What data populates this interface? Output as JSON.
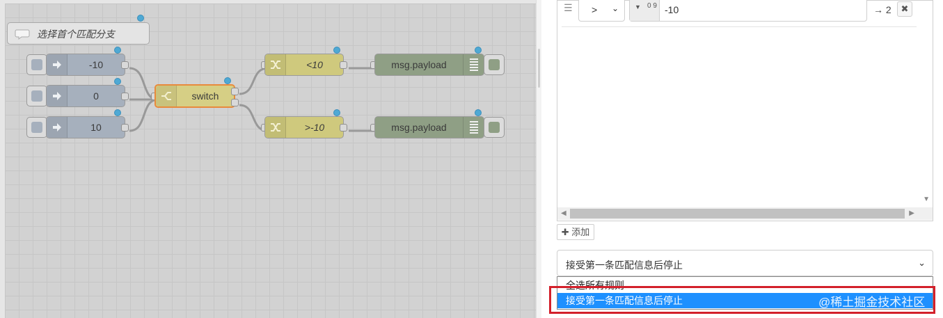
{
  "workspace": {
    "comment_label": "选择首个匹配分支",
    "inject_nodes": [
      {
        "label": "-10"
      },
      {
        "label": "0"
      },
      {
        "label": "10"
      }
    ],
    "switch_node": {
      "label": "switch"
    },
    "change_nodes": [
      {
        "label": "<10"
      },
      {
        "label": ">-10"
      }
    ],
    "debug_nodes": [
      {
        "label": "msg.payload"
      },
      {
        "label": "msg.payload"
      }
    ]
  },
  "rule": {
    "operator": ">",
    "value_type": "0 9",
    "value": "-10",
    "output": "→ 2"
  },
  "add_button": "✚ 添加",
  "mode_select": {
    "value": "接受第一条匹配信息后停止",
    "options": [
      "全选所有规则",
      "接受第一条匹配信息后停止"
    ]
  },
  "watermark": "@稀土掘金技术社区",
  "colors": {
    "inject": "#a6b0bd",
    "switch": "#d6cf85",
    "change": "#cfc97d",
    "debug": "#8f9f85",
    "selected": "#1e90ff",
    "highlight": "#d3202b"
  }
}
